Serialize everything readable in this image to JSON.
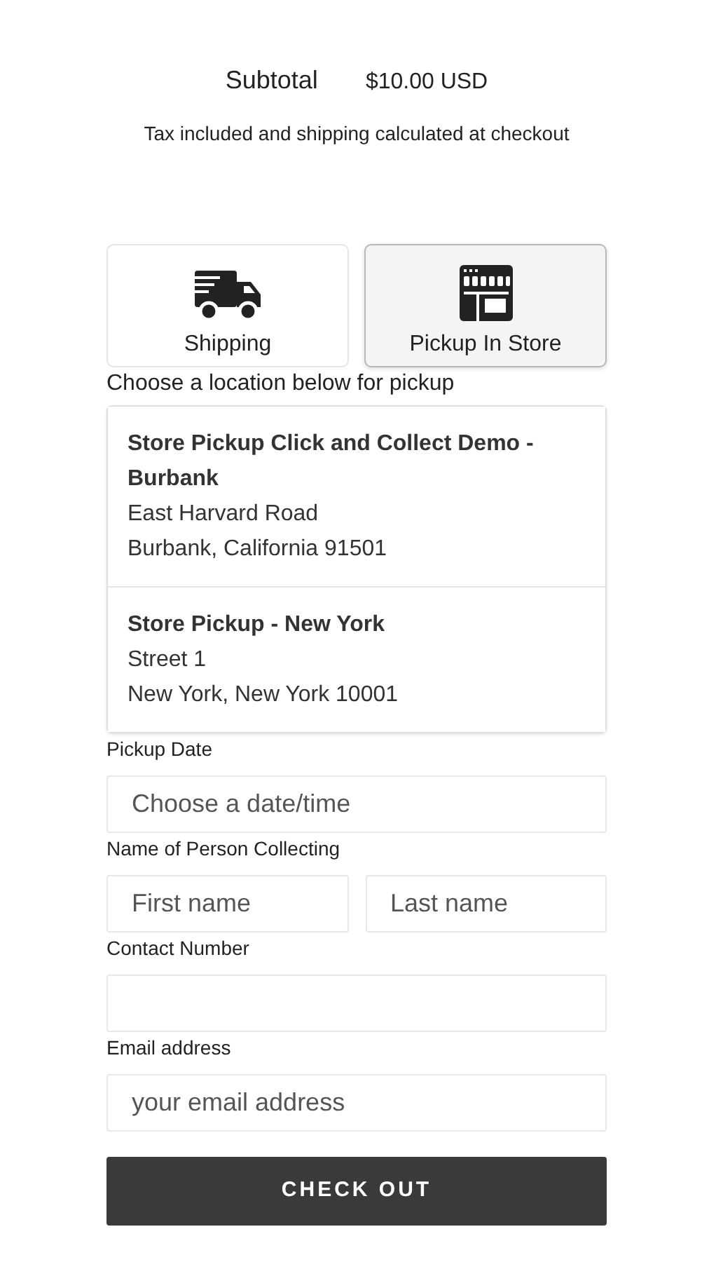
{
  "summary": {
    "label": "Subtotal",
    "amount": "$10.00 USD",
    "note": "Tax included and shipping calculated at checkout"
  },
  "delivery_tabs": [
    {
      "label": "Shipping",
      "kind": "truck",
      "selected": false
    },
    {
      "label": "Pickup In Store",
      "kind": "store",
      "selected": true
    }
  ],
  "location_prompt": "Choose a location below for pickup",
  "locations": [
    {
      "name": "Store Pickup Click and Collect Demo - Burbank",
      "lines": [
        "East Harvard Road",
        "Burbank, California 91501"
      ]
    },
    {
      "name": "Store Pickup - New York",
      "lines": [
        "Street 1",
        "New York, New York 10001"
      ]
    }
  ],
  "fields": [
    {
      "label": "Pickup Date",
      "inputs": [
        {
          "kind": "text",
          "placeholder": "Choose a date/time"
        }
      ]
    },
    {
      "label": "Name of Person Collecting",
      "inputs": [
        {
          "kind": "text",
          "placeholder": "First name"
        },
        {
          "kind": "text",
          "placeholder": "Last name"
        }
      ]
    },
    {
      "label": "Contact Number",
      "inputs": [
        {
          "kind": "text"
        }
      ]
    },
    {
      "label": "Email address",
      "inputs": [
        {
          "kind": "text",
          "placeholder": "your email address"
        }
      ]
    }
  ],
  "checkout_button": "CHECK OUT"
}
